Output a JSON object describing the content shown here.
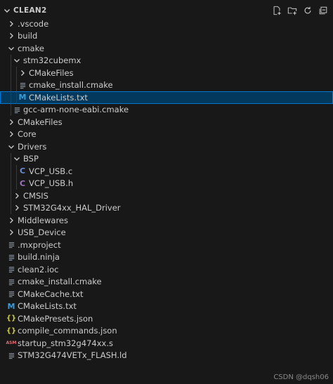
{
  "header": {
    "title": "CLEAN2"
  },
  "colors": {
    "background": "#181818",
    "selected_bg": "#04395e",
    "selected_border": "#0078d4",
    "cmake_icon": "#3a9bd9",
    "c_icon": "#6b8dd6",
    "h_icon": "#a074c4",
    "json_icon": "#cbcb41",
    "asm_icon": "#e06c75"
  },
  "tree": [
    {
      "label": ".vscode",
      "kind": "folder",
      "state": "collapsed",
      "depth": 0,
      "icon": "chevron-right-icon"
    },
    {
      "label": "build",
      "kind": "folder",
      "state": "collapsed",
      "depth": 0,
      "icon": "chevron-right-icon"
    },
    {
      "label": "cmake",
      "kind": "folder",
      "state": "expanded",
      "depth": 0,
      "icon": "chevron-down-icon"
    },
    {
      "label": "stm32cubemx",
      "kind": "folder",
      "state": "expanded",
      "depth": 1,
      "icon": "chevron-down-icon"
    },
    {
      "label": "CMakeFiles",
      "kind": "folder",
      "state": "collapsed",
      "depth": 2,
      "icon": "chevron-right-icon"
    },
    {
      "label": "cmake_install.cmake",
      "kind": "file",
      "depth": 2,
      "icon": "lines-file-icon"
    },
    {
      "label": "CMakeLists.txt",
      "kind": "file",
      "depth": 2,
      "icon": "cmake-icon",
      "selected": true
    },
    {
      "label": "gcc-arm-none-eabi.cmake",
      "kind": "file",
      "depth": 1,
      "icon": "lines-file-icon"
    },
    {
      "label": "CMakeFiles",
      "kind": "folder",
      "state": "collapsed",
      "depth": 0,
      "icon": "chevron-right-icon"
    },
    {
      "label": "Core",
      "kind": "folder",
      "state": "collapsed",
      "depth": 0,
      "icon": "chevron-right-icon"
    },
    {
      "label": "Drivers",
      "kind": "folder",
      "state": "expanded",
      "depth": 0,
      "icon": "chevron-down-icon"
    },
    {
      "label": "BSP",
      "kind": "folder",
      "state": "expanded",
      "depth": 1,
      "icon": "chevron-down-icon"
    },
    {
      "label": "VCP_USB.c",
      "kind": "file",
      "depth": 2,
      "icon": "c-file-icon"
    },
    {
      "label": "VCP_USB.h",
      "kind": "file",
      "depth": 2,
      "icon": "h-file-icon"
    },
    {
      "label": "CMSIS",
      "kind": "folder",
      "state": "collapsed",
      "depth": 1,
      "icon": "chevron-right-icon"
    },
    {
      "label": "STM32G4xx_HAL_Driver",
      "kind": "folder",
      "state": "collapsed",
      "depth": 1,
      "icon": "chevron-right-icon"
    },
    {
      "label": "Middlewares",
      "kind": "folder",
      "state": "collapsed",
      "depth": 0,
      "icon": "chevron-right-icon"
    },
    {
      "label": "USB_Device",
      "kind": "folder",
      "state": "collapsed",
      "depth": 0,
      "icon": "chevron-right-icon"
    },
    {
      "label": ".mxproject",
      "kind": "file",
      "depth": 0,
      "icon": "lines-file-icon"
    },
    {
      "label": "build.ninja",
      "kind": "file",
      "depth": 0,
      "icon": "lines-file-icon"
    },
    {
      "label": "clean2.ioc",
      "kind": "file",
      "depth": 0,
      "icon": "lines-file-icon"
    },
    {
      "label": "cmake_install.cmake",
      "kind": "file",
      "depth": 0,
      "icon": "lines-file-icon"
    },
    {
      "label": "CMakeCache.txt",
      "kind": "file",
      "depth": 0,
      "icon": "lines-file-icon"
    },
    {
      "label": "CMakeLists.txt",
      "kind": "file",
      "depth": 0,
      "icon": "cmake-icon"
    },
    {
      "label": "CMakePresets.json",
      "kind": "file",
      "depth": 0,
      "icon": "json-file-icon"
    },
    {
      "label": "compile_commands.json",
      "kind": "file",
      "depth": 0,
      "icon": "json-file-icon"
    },
    {
      "label": "startup_stm32g474xx.s",
      "kind": "file",
      "depth": 0,
      "icon": "asm-file-icon"
    },
    {
      "label": "STM32G474VETx_FLASH.ld",
      "kind": "file",
      "depth": 0,
      "icon": "lines-file-icon"
    }
  ],
  "watermark": "CSDN @dqsh06"
}
